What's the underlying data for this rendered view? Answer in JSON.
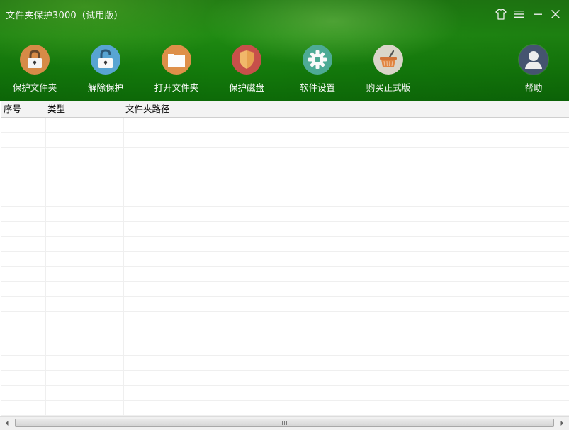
{
  "window": {
    "title": "文件夹保护3000（试用版）"
  },
  "toolbar": {
    "items": [
      {
        "label": "保护文件夹",
        "icon": "lock-closed-icon",
        "color": "#e0914a"
      },
      {
        "label": "解除保护",
        "icon": "lock-open-icon",
        "color": "#5aa9d8"
      },
      {
        "label": "打开文件夹",
        "icon": "folder-icon",
        "color": "#e0914a"
      },
      {
        "label": "保护磁盘",
        "icon": "shield-icon",
        "color": "#c8504a"
      },
      {
        "label": "软件设置",
        "icon": "gear-icon",
        "color": "#4fae98"
      },
      {
        "label": "购买正式版",
        "icon": "basket-icon",
        "color": "#e2ddd0"
      },
      {
        "label": "帮助",
        "icon": "user-icon",
        "color": "#4a5a78"
      }
    ]
  },
  "table": {
    "columns": [
      "序号",
      "类型",
      "文件夹路径"
    ],
    "rows": []
  },
  "colors": {
    "header_green": "#1f8a12",
    "header_dark_green": "#0d6a08"
  }
}
